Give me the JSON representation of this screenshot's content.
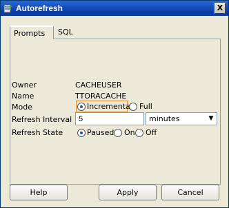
{
  "window": {
    "title": "Autorefresh",
    "close_glyph": "X"
  },
  "tabs": [
    {
      "label": "Prompts",
      "active": true
    },
    {
      "label": "SQL",
      "active": false
    }
  ],
  "form": {
    "owner": {
      "label": "Owner",
      "value": "CACHEUSER"
    },
    "name": {
      "label": "Name",
      "value": "TTORACACHE"
    },
    "mode": {
      "label": "Mode",
      "options": [
        {
          "label": "Incremental",
          "selected": true
        },
        {
          "label": "Full",
          "selected": false
        }
      ]
    },
    "refresh_interval": {
      "label": "Refresh Interval",
      "value": "5",
      "unit": "minutes"
    },
    "refresh_state": {
      "label": "Refresh State",
      "options": [
        {
          "label": "Paused",
          "selected": true
        },
        {
          "label": "On",
          "selected": false
        },
        {
          "label": "Off",
          "selected": false
        }
      ]
    }
  },
  "buttons": {
    "help": "Help",
    "apply": "Apply",
    "cancel": "Cancel"
  },
  "icons": {
    "app": "database-refresh-icon",
    "close": "close-icon",
    "dropdown": "chevron-down-icon"
  },
  "colors": {
    "titlebar": "#0a3fa8",
    "radio_dot": "#1e4dbd",
    "focus": "#d88f32"
  }
}
